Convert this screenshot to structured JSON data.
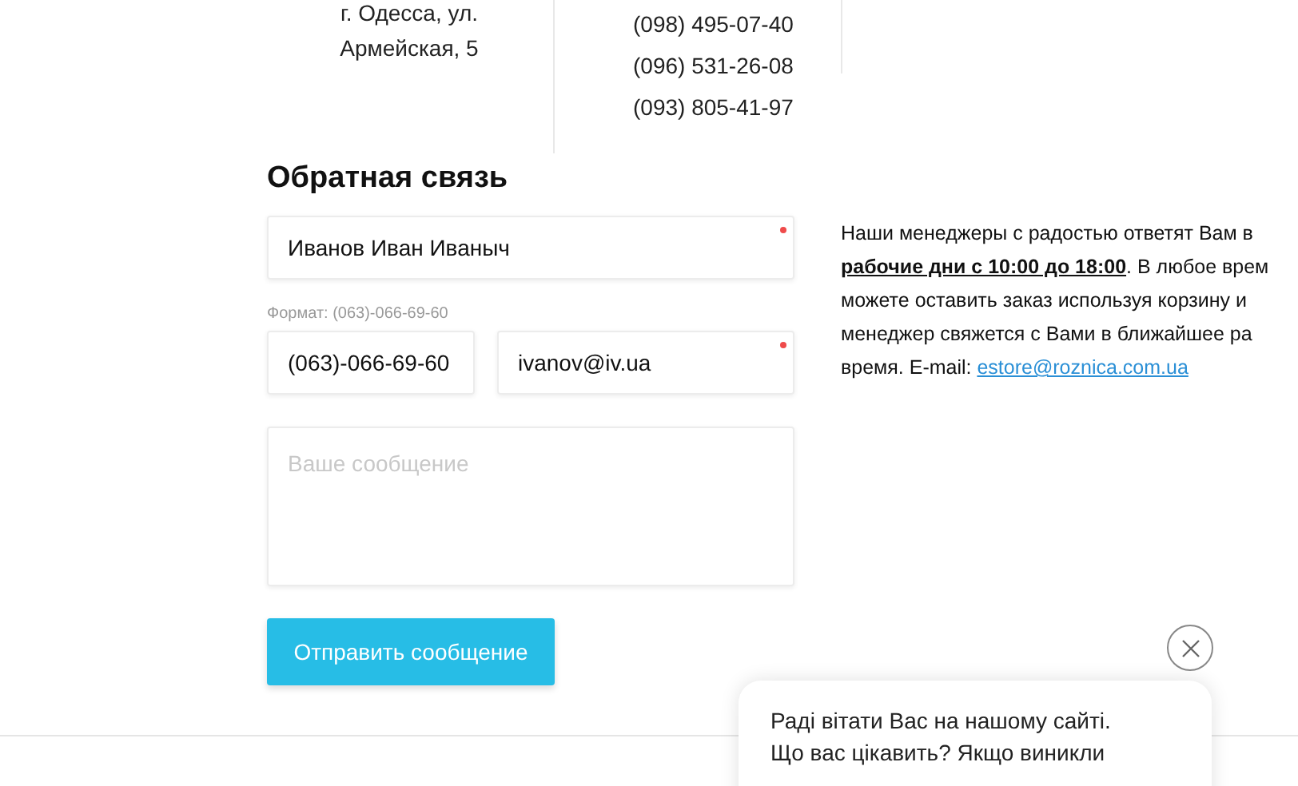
{
  "address": {
    "lines": [
      "г. Одесса, ул.",
      "Армейская, 5"
    ]
  },
  "phones": [
    "(098) 495-07-40",
    "(096) 531-26-08",
    "(093) 805-41-97"
  ],
  "feedback": {
    "title": "Обратная связь",
    "name_field": {
      "value": "Иванов Иван Иваныч",
      "required": true
    },
    "phone_hint": "Формат: (063)-066-69-60",
    "phone_field": {
      "value": "(063)-066-69-60",
      "required": false
    },
    "email_field": {
      "value": "ivanov@iv.ua",
      "required": true
    },
    "message_field": {
      "placeholder": "Ваше сообщение"
    },
    "submit_button": "Отправить сообщение"
  },
  "info": {
    "lines": [
      "Наши менеджеры с радостью ответят Вам в",
      "**рабочие дни с 10:00 до 18:00**. В любое врем",
      "можете оставить заказ используя корзину и",
      "менеджер свяжется с Вами в ближайшее ра",
      "время. E-mail: "
    ],
    "email_link": "estore@roznica.com.ua"
  },
  "chat_popup": {
    "lines": [
      "Раді вітати Вас на нашому сайті.",
      "Що вас цікавить? Якщо виникли"
    ]
  }
}
